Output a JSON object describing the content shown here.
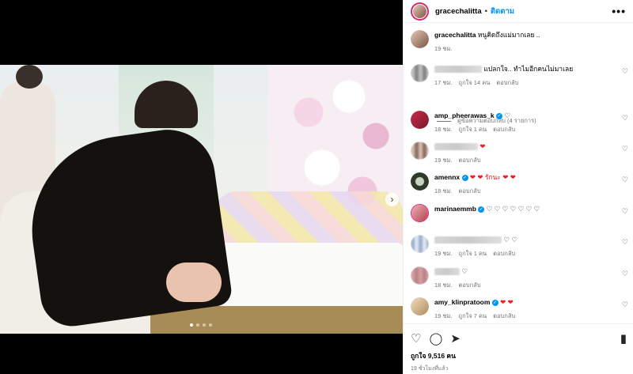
{
  "post": {
    "username": "gracechalitta",
    "separator": "•",
    "follow_label": "ติดตาม",
    "more_label": "•••",
    "caption": "หนูคิดถึงแม่มากเลย ..",
    "caption_time": "19 ชม.",
    "next_icon": "chevron-right-icon",
    "media_slide_count": 4
  },
  "comments": [
    {
      "user": "",
      "text": "แปลกใจ.. ทำไมอีกคนไม่มาเลย",
      "time": "17 ชม.",
      "likes": "ถูกใจ 14 คน",
      "reply": "ตอบกลับ"
    },
    {
      "user": "amp_pheerawas_k",
      "verified": true,
      "text": "♡",
      "time": "18 ชม.",
      "likes": "ถูกใจ 1 คน",
      "reply": "ตอบกลับ"
    },
    {
      "user": "",
      "text": "❤",
      "time": "19 ชม.",
      "likes": "",
      "reply": "ตอบกลับ"
    },
    {
      "user": "amennx",
      "verified": true,
      "text": "❤ ❤ รักนะ ❤ ❤",
      "time": "18 ชม.",
      "likes": "",
      "reply": "ตอบกลับ"
    },
    {
      "user": "marinaemmb",
      "verified": true,
      "text": "♡ ♡ ♡ ♡ ♡ ♡ ♡",
      "time": "",
      "likes": "",
      "reply": ""
    },
    {
      "user": "",
      "text": "♡ ♡",
      "time": "19 ชม.",
      "likes": "ถูกใจ 1 คน",
      "reply": "ตอบกลับ"
    },
    {
      "user": "",
      "text": "♡",
      "time": "18 ชม.",
      "likes": "",
      "reply": "ตอบกลับ"
    },
    {
      "user": "amy_klinpratoom",
      "verified": true,
      "text": "❤ ❤",
      "time": "19 ชม.",
      "likes": "ถูกใจ 7 คน",
      "reply": "ตอบกลับ"
    }
  ],
  "view_replies": "ดูข้อความตอบกลับ (4 รายการ)",
  "actions": {
    "like_icon": "heart-icon",
    "comment_icon": "comment-icon",
    "share_icon": "send-icon",
    "save_icon": "bookmark-icon",
    "likes_text": "ถูกใจ 9,516 คน",
    "posted_time": "19 ชั่วโมงที่แล้ว"
  },
  "colors": {
    "accent": "#0095f6",
    "heart_red": "#ed1c24",
    "story_ring": "#d62976"
  }
}
